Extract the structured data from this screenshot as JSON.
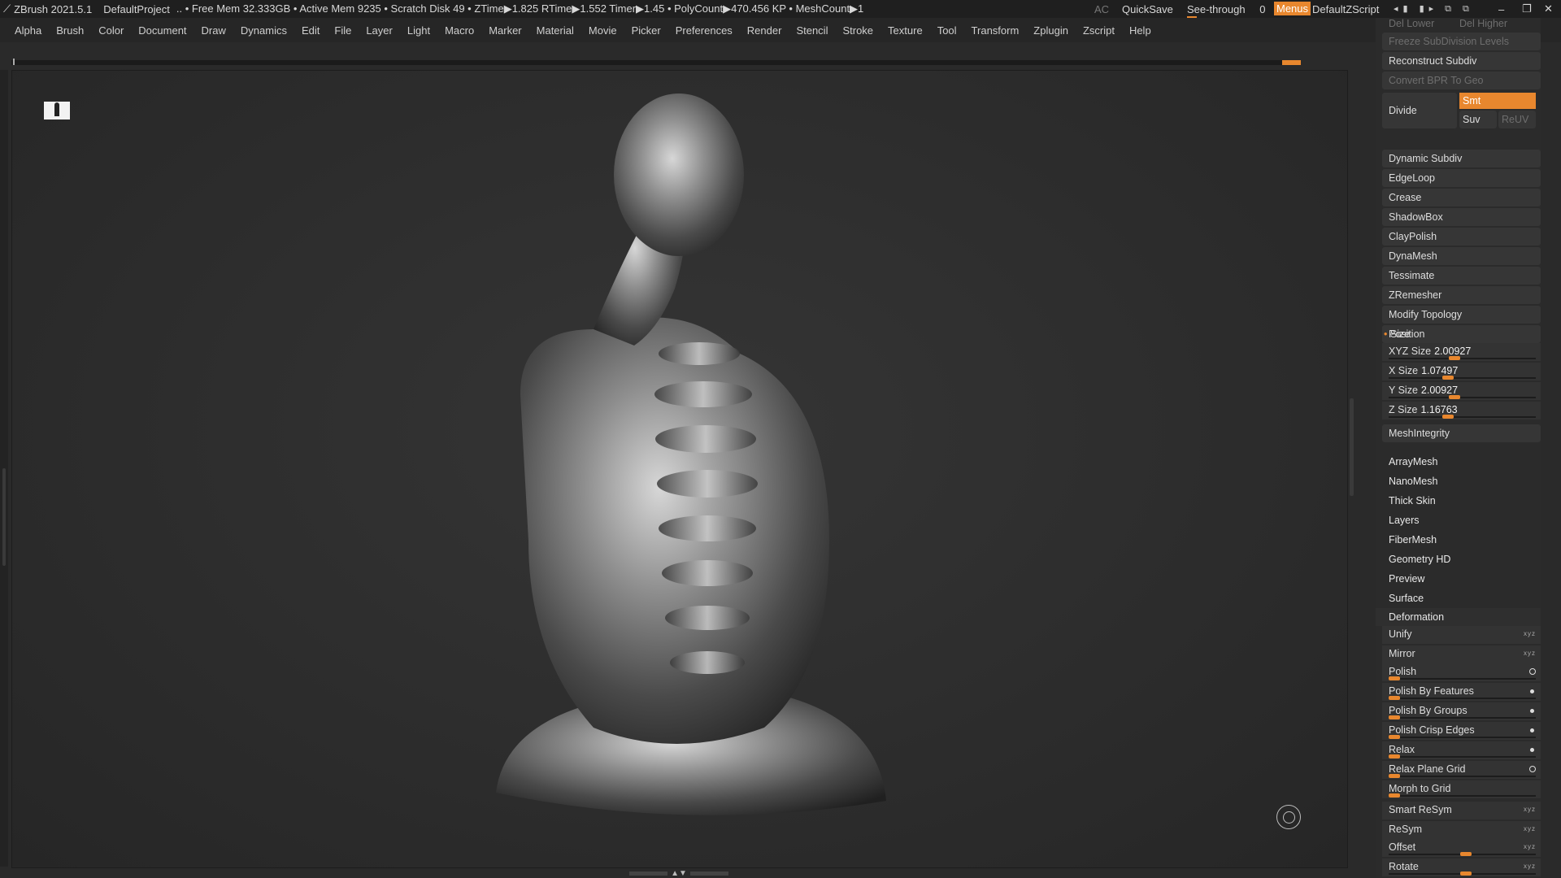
{
  "titlebar": {
    "app": "ZBrush 2021.5.1",
    "project": "DefaultProject",
    "stats": ".. • Free Mem 32.333GB • Active Mem 9235 • Scratch Disk 49 • ZTime▶1.825 RTime▶1.552 Timer▶1.45 • PolyCount▶470.456 KP • MeshCount▶1",
    "ac": "AC",
    "quicksave": "QuickSave",
    "seethrough_label": "See-through",
    "seethrough_value": "0",
    "menus_label": "Menus",
    "zscript": "DefaultZScript",
    "accent": "#e8872e"
  },
  "menubar": [
    "Alpha",
    "Brush",
    "Color",
    "Document",
    "Draw",
    "Dynamics",
    "Edit",
    "File",
    "Layer",
    "Light",
    "Macro",
    "Marker",
    "Material",
    "Movie",
    "Picker",
    "Preferences",
    "Render",
    "Stencil",
    "Stroke",
    "Texture",
    "Tool",
    "Transform",
    "Zplugin",
    "Zscript",
    "Help"
  ],
  "panel": {
    "del_lower": "Del Lower",
    "del_higher": "Del Higher",
    "freeze": "Freeze SubDivision Levels",
    "reconstruct": "Reconstruct Subdiv",
    "convert_bpr": "Convert BPR To Geo",
    "divide": "Divide",
    "smt": "Smt",
    "suv": "Suv",
    "reuv": "ReUV",
    "items": [
      "Dynamic Subdiv",
      "EdgeLoop",
      "Crease",
      "ShadowBox",
      "ClayPolish",
      "DynaMesh",
      "Tessimate",
      "ZRemesher",
      "Modify Topology",
      "Position"
    ],
    "size_header": "Size",
    "xyz_size_label": "XYZ Size",
    "xyz_size": "2.00927",
    "x_size_label": "X Size",
    "x_size": "1.07497",
    "y_size_label": "Y Size",
    "y_size": "2.00927",
    "z_size_label": "Z Size",
    "z_size": "1.16763",
    "meshintegrity": "MeshIntegrity",
    "subpalettes": [
      "ArrayMesh",
      "NanoMesh",
      "Thick Skin",
      "Layers",
      "FiberMesh",
      "Geometry HD",
      "Preview",
      "Surface"
    ],
    "deformation_header": "Deformation",
    "unify": "Unify",
    "mirror": "Mirror",
    "polish": "Polish",
    "polish_features": "Polish By Features",
    "polish_groups": "Polish By Groups",
    "polish_crisp": "Polish Crisp Edges",
    "relax": "Relax",
    "relax_plane": "Relax Plane Grid",
    "morph_grid": "Morph to Grid",
    "smart_resym": "Smart ReSym",
    "resym": "ReSym",
    "offset": "Offset",
    "rotate": "Rotate"
  }
}
